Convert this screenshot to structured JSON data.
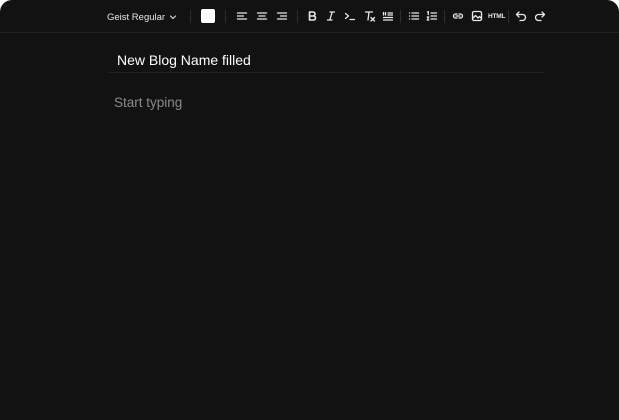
{
  "toolbar": {
    "font_family": "Geist Regular",
    "text_color": "#ffffff",
    "html_label": "HTML",
    "icons": [
      "chevron-down-icon",
      "align-left-icon",
      "align-center-icon",
      "align-right-icon",
      "bold-icon",
      "italic-icon",
      "code-icon",
      "clear-format-icon",
      "blockquote-icon",
      "bullet-list-icon",
      "ordered-list-icon",
      "link-icon",
      "image-icon",
      "undo-icon",
      "redo-icon"
    ]
  },
  "editor": {
    "title_value": "New Blog Name filled",
    "body_placeholder": "Start typing"
  },
  "colors": {
    "background": "#121212",
    "divider": "#1f1f1f",
    "placeholder": "#8a8a8a"
  }
}
